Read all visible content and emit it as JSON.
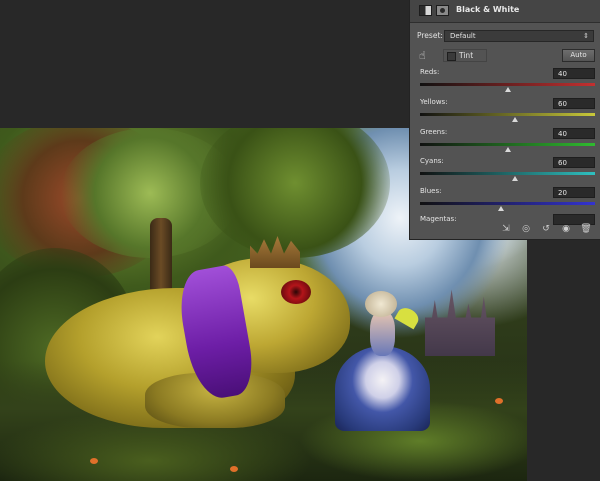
{
  "panel": {
    "title": "Black & White",
    "preset_label": "Preset:",
    "preset_value": "Default",
    "tint_label": "Tint",
    "auto_label": "Auto",
    "sliders": [
      {
        "label": "Reds:",
        "value": "40",
        "colors": [
          "#111111",
          "#c33030"
        ],
        "level": 0.5
      },
      {
        "label": "Yellows:",
        "value": "60",
        "colors": [
          "#111111",
          "#c8c83a"
        ],
        "level": 0.54
      },
      {
        "label": "Greens:",
        "value": "40",
        "colors": [
          "#111111",
          "#2fbb2f"
        ],
        "level": 0.5
      },
      {
        "label": "Cyans:",
        "value": "60",
        "colors": [
          "#111111",
          "#2ec0c0"
        ],
        "level": 0.54
      },
      {
        "label": "Blues:",
        "value": "20",
        "colors": [
          "#111111",
          "#3333d0"
        ],
        "level": 0.46
      }
    ],
    "magentas_label": "Magentas:",
    "footer_icons": [
      "clip-to-layer-icon",
      "view-previous-icon",
      "reset-icon",
      "visibility-eye-icon",
      "trash-icon"
    ]
  }
}
